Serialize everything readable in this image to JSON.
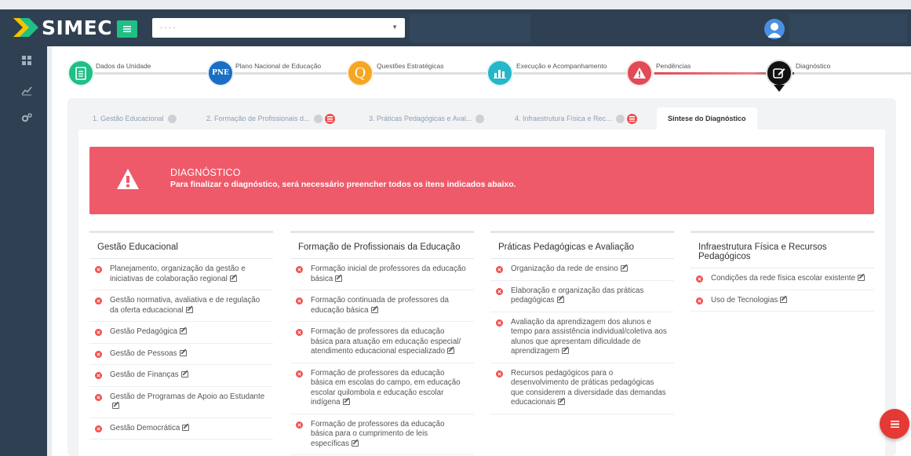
{
  "app": {
    "logo_text": "SIMEC"
  },
  "header": {
    "select_value": ". . . .",
    "colors": {
      "bar": "#2f4052",
      "toggle": "#1fbf86"
    }
  },
  "stepper": [
    {
      "label": "Dados da Unidade",
      "icon": "document-icon",
      "color": "#1fbf86"
    },
    {
      "label": "Plano Nacional de Educação",
      "icon": "pne-icon",
      "badge": "PNE",
      "color": "#1a6fc4"
    },
    {
      "label": "Questões Estratégicas",
      "icon": "q-icon",
      "badge": "Q",
      "color": "#f5a623"
    },
    {
      "label": "Execução e Acompanhamento",
      "icon": "chart-icon",
      "color": "#23b7c9"
    },
    {
      "label": "Pendências",
      "icon": "warning-icon",
      "color": "#e04b57"
    },
    {
      "label": "Diagnóstico",
      "icon": "edit-icon",
      "color": "#111111"
    }
  ],
  "tabs": [
    {
      "label": "1. Gestão Educacional"
    },
    {
      "label": "2. Formação de Profissionais d..."
    },
    {
      "label": "3. Práticas Pedagógicas e Aval..."
    },
    {
      "label": "4. Infraestrutura Física e Rec..."
    },
    {
      "label": "Síntese do Diagnóstico"
    }
  ],
  "alert": {
    "title": "DIAGNÓSTICO",
    "text": "Para finalizar o diagnóstico, será necessário preencher todos os itens indicados abaixo.",
    "color": "#ee5a6a"
  },
  "columns": [
    {
      "title": "Gestão Educacional",
      "items": [
        "Planejamento, organização da gestão e iniciativas de colaboração regional",
        "Gestão normativa, avaliativa e de regulação da oferta educacional",
        "Gestão Pedagógica",
        "Gestão de Pessoas",
        "Gestão de Finanças",
        "Gestão de Programas de Apoio ao Estudante",
        "Gestão Democrática"
      ]
    },
    {
      "title": "Formação de Profissionais da Educação",
      "items": [
        "Formação inicial de professores da educação básica",
        "Formação continuada de professores da educação básica",
        "Formação de professores da educação básica para atuação em educação especial/ atendimento educacional especializado",
        "Formação de professores da educação básica em escolas do campo, em educação escolar quilombola e educação escolar indígena",
        "Formação de professores da educação básica para o cumprimento de leis específicas"
      ]
    },
    {
      "title": "Práticas Pedagógicas e Avaliação",
      "items": [
        "Organização da rede de ensino",
        "Elaboração e organização das práticas pedagógicas",
        "Avaliação da aprendizagem dos alunos e tempo para assistência individual/coletiva aos alunos que apresentam dificuldade de aprendizagem",
        "Recursos pedagógicos para o desenvolvimento de práticas pedagógicas que considerem a diversidade das demandas educacionais"
      ]
    },
    {
      "title": "Infraestrutura Física e Recursos Pedagógicos",
      "items": [
        "Condições da rede física escolar existente",
        "Uso de Tecnologias"
      ]
    }
  ]
}
